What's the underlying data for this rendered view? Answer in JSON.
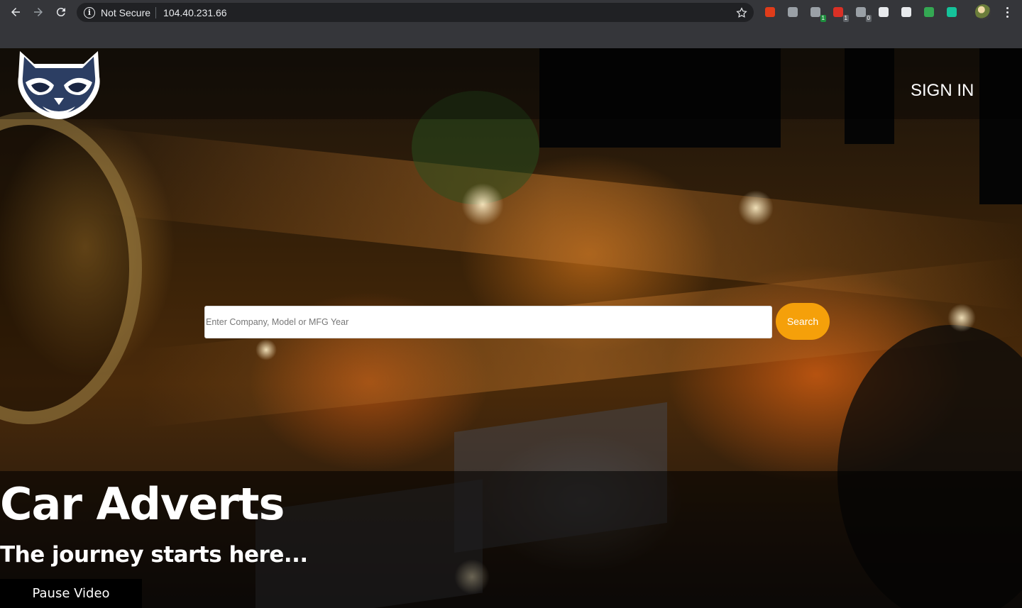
{
  "browser": {
    "security_status": "Not Secure",
    "url": "104.40.231.66",
    "extensions": [
      {
        "name": "office-icon",
        "color": "#e03c1a",
        "badge": ""
      },
      {
        "name": "camera-icon",
        "color": "#9aa0a6",
        "badge": ""
      },
      {
        "name": "extension-icon-1",
        "color": "#9aa0a6",
        "badge": "1",
        "badge_color": "#1e8e3e"
      },
      {
        "name": "extension-icon-2",
        "color": "#d93025",
        "badge": "1",
        "badge_color": "#5f6368"
      },
      {
        "name": "extension-icon-3",
        "color": "#9aa0a6",
        "badge": "0",
        "badge_color": "#5f6368"
      },
      {
        "name": "extension-icon-4",
        "color": "#e8eaed",
        "badge": ""
      },
      {
        "name": "extension-icon-5",
        "color": "#e8eaed",
        "badge": ""
      },
      {
        "name": "extension-icon-6",
        "color": "#34a853",
        "badge": ""
      },
      {
        "name": "grammarly-icon",
        "color": "#15c39a",
        "badge": ""
      }
    ]
  },
  "header": {
    "logo": "raccoon-logo",
    "sign_in_label": "SIGN IN"
  },
  "search": {
    "placeholder": "Enter Company, Model or MFG Year",
    "button_label": "Search",
    "button_color": "#f5a00a"
  },
  "hero": {
    "title": "Car Adverts",
    "subtitle": "The journey starts here..."
  },
  "video": {
    "pause_label": "Pause Video"
  }
}
